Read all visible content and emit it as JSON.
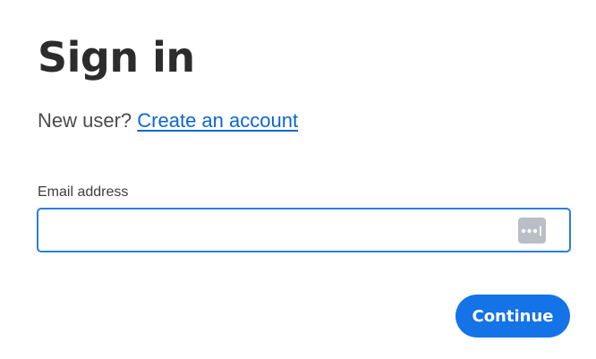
{
  "signin": {
    "title": "Sign in",
    "new_user_prompt": "New user?",
    "create_account_link": "Create an account"
  },
  "email": {
    "label": "Email address",
    "value": "",
    "placeholder": "",
    "autofill_icon": "password-manager-icon"
  },
  "actions": {
    "continue_label": "Continue"
  },
  "colors": {
    "link": "#0d66d0",
    "field_border": "#2a7de1",
    "primary_button": "#1473e6",
    "icon_bg": "#b9bec7"
  }
}
